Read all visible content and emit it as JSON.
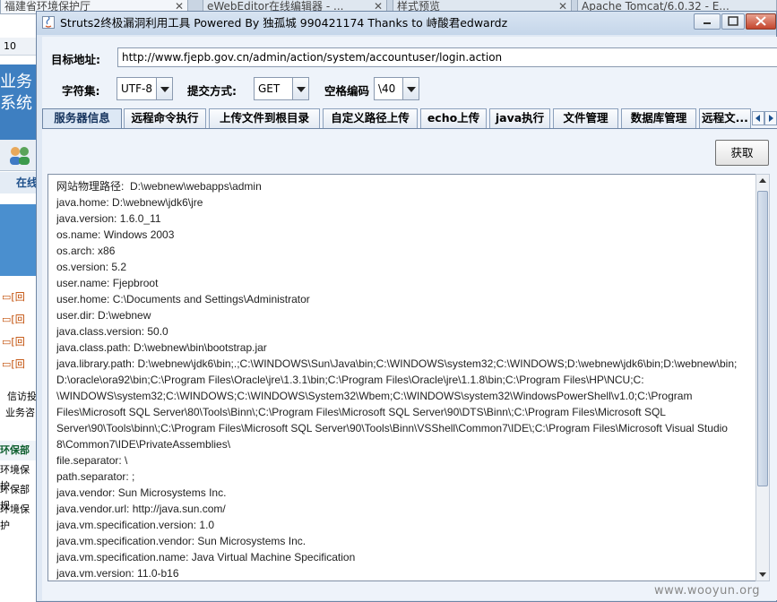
{
  "browser": {
    "tabs": [
      {
        "label": "福建省环境保护厅"
      },
      {
        "label": "eWebEditor在线编辑器 - ..."
      },
      {
        "label": "样式预览"
      },
      {
        "label": "Apache Tomcat/6.0.32 - E..."
      }
    ],
    "left_page": {
      "row_number": "10",
      "banner_text": "业务\n系统",
      "zai_text": "在线",
      "link_text": "[回",
      "info_text": "信访投",
      "biz_text": "业务咨",
      "section_title": "环保部",
      "items": [
        "环境保护",
        "环保部规",
        "环境保护"
      ]
    }
  },
  "window": {
    "title": "Struts2终极漏洞利用工具   Powered By 独孤城 990421174 Thanks to 峙酸君edwardz"
  },
  "form": {
    "target_label": "目标地址:",
    "target_url": "http://www.fjepb.gov.cn/admin/action/system/accountuser/login.action",
    "charset_label": "字符集:",
    "charset_value": "UTF-8",
    "method_label": "提交方式:",
    "method_value": "GET",
    "space_label": "空格编码",
    "space_value": "\\40"
  },
  "tabs": [
    {
      "label": "服务器信息",
      "active": true
    },
    {
      "label": "远程命令执行"
    },
    {
      "label": "上传文件到根目录"
    },
    {
      "label": "自定义路径上传"
    },
    {
      "label": "echo上传"
    },
    {
      "label": "java执行"
    },
    {
      "label": "文件管理"
    },
    {
      "label": "数据库管理"
    },
    {
      "label": "远程文..."
    }
  ],
  "panel": {
    "get_button": "获取",
    "output_lines": [
      "网站物理路径:  D:\\webnew\\webapps\\admin",
      "java.home: D:\\webnew\\jdk6\\jre",
      "java.version: 1.6.0_11",
      "os.name: Windows 2003",
      "os.arch: x86",
      "os.version: 5.2",
      "user.name: Fjepbroot",
      "user.home: C:\\Documents and Settings\\Administrator",
      "user.dir: D:\\webnew",
      "java.class.version: 50.0",
      "java.class.path: D:\\webnew\\bin\\bootstrap.jar",
      "java.library.path: D:\\webnew\\jdk6\\bin;.;C:\\WINDOWS\\Sun\\Java\\bin;C:\\WINDOWS\\system32;C:\\WINDOWS;D:\\webnew\\jdk6\\bin;D:\\webnew\\bin;",
      "D:\\oracle\\ora92\\bin;C:\\Program Files\\Oracle\\jre\\1.3.1\\bin;C:\\Program Files\\Oracle\\jre\\1.1.8\\bin;C:\\Program Files\\HP\\NCU;C:",
      "\\WINDOWS\\system32;C:\\WINDOWS;C:\\WINDOWS\\System32\\Wbem;C:\\WINDOWS\\system32\\WindowsPowerShell\\v1.0;C:\\Program",
      "Files\\Microsoft SQL Server\\80\\Tools\\Binn\\;C:\\Program Files\\Microsoft SQL Server\\90\\DTS\\Binn\\;C:\\Program Files\\Microsoft SQL",
      "Server\\90\\Tools\\binn\\;C:\\Program Files\\Microsoft SQL Server\\90\\Tools\\Binn\\VSShell\\Common7\\IDE\\;C:\\Program Files\\Microsoft Visual Studio",
      "8\\Common7\\IDE\\PrivateAssemblies\\",
      "file.separator: \\",
      "path.separator: ;",
      "java.vendor: Sun Microsystems Inc.",
      "java.vendor.url: http://java.sun.com/",
      "java.vm.specification.version: 1.0",
      "java.vm.specification.vendor: Sun Microsystems Inc.",
      "java.vm.specification.name: Java Virtual Machine Specification",
      "java.vm.version: 11.0-b16"
    ]
  },
  "watermark": "www.wooyun.org"
}
